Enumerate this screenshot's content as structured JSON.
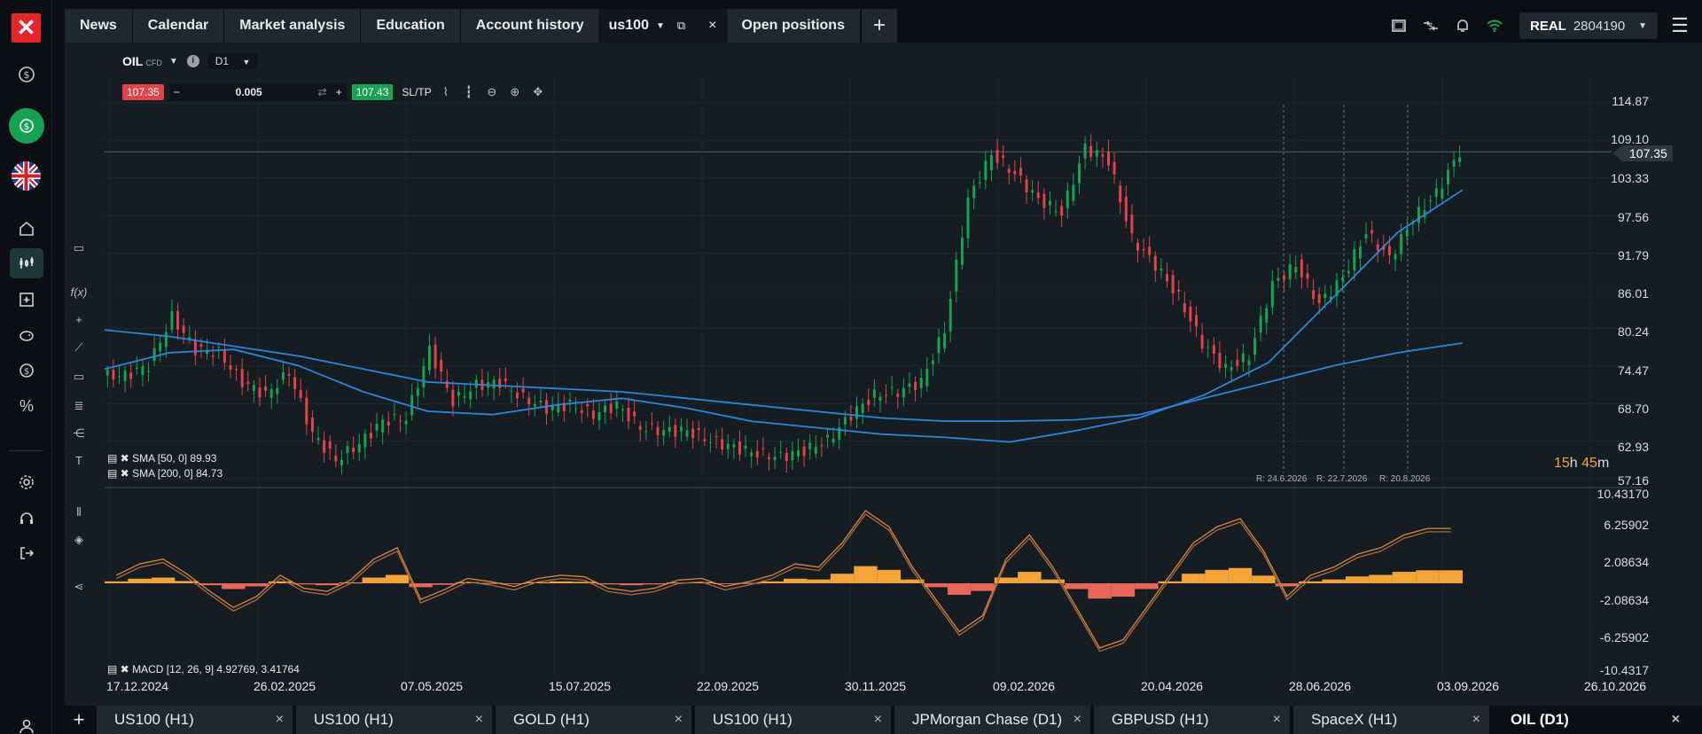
{
  "brand": {
    "logo_icon": "xtb-logo-icon"
  },
  "rail": {
    "icons": [
      "dollar-circle-icon",
      "deposit-icon",
      "uk-flag-icon",
      "home-icon",
      "charts-icon",
      "news-icon",
      "piggy-bank-icon",
      "money-icon",
      "percent-icon",
      "settings-icon",
      "headset-icon",
      "logout-icon",
      "user-icon"
    ]
  },
  "topbar": {
    "tabs": [
      "News",
      "Calendar",
      "Market analysis",
      "Education",
      "Account history"
    ],
    "symbol_tab": "us100",
    "open_positions": "Open positions",
    "add": "+"
  },
  "account": {
    "type": "REAL",
    "number": "2804190"
  },
  "chart": {
    "symbol": "OIL",
    "symbol_type": "CFD",
    "timeframe": "D1",
    "sell_price": "107.35",
    "buy_price": "107.43",
    "volume": "0.005",
    "sltp": "SL/TP",
    "current_price": "107.35",
    "timer_hours": "15",
    "timer_h": "h",
    "timer_minutes": "45",
    "timer_m": "m",
    "sma50": "SMA [50, 0] 89.93",
    "sma200": "SMA [200, 0] 84.73",
    "macd": "MACD [12, 26, 9] 4.92769, 3.41764",
    "r_lines": [
      "R: 24.6.2026",
      "R: 22.7.2026",
      "R: 20.8.2026"
    ]
  },
  "chart_data": {
    "type": "line",
    "title": "",
    "price_axis": [
      "114.87",
      "109.10",
      "103.33",
      "97.56",
      "91.79",
      "86.01",
      "80.24",
      "74.47",
      "68.70",
      "62.93",
      "57.16"
    ],
    "macd_axis": [
      "10.43170",
      "6.25902",
      "2.08634",
      "-2.08634",
      "-6.25902",
      "-10.4317"
    ],
    "x_labels": [
      "17.12.2024",
      "26.02.2025",
      "07.05.2025",
      "15.07.2025",
      "22.09.2025",
      "30.11.2025",
      "09.02.2026",
      "20.04.2026",
      "28.06.2026",
      "03.09.2026",
      "26.10.2026"
    ],
    "ylim": [
      57.16,
      114.87
    ],
    "x": [
      0,
      30,
      60,
      90,
      120,
      150,
      180,
      210,
      240,
      270,
      300,
      330,
      360,
      390,
      420,
      450,
      480,
      510,
      540,
      570,
      600,
      630
    ],
    "series": [
      {
        "name": "SMA [50, 0]",
        "color": "#2b86d9",
        "values": [
          74.0,
          76.5,
          77.0,
          74.5,
          70.5,
          67.5,
          67.0,
          68.5,
          69.5,
          68.0,
          66.0,
          65.0,
          64.0,
          63.5,
          62.8,
          64.5,
          66.5,
          70.0,
          75.0,
          85.0,
          95.0,
          101.5
        ]
      },
      {
        "name": "SMA [200, 0]",
        "color": "#2b86d9",
        "values": [
          80.0,
          79.0,
          77.5,
          76.0,
          74.0,
          72.0,
          71.5,
          71.0,
          70.5,
          69.5,
          68.5,
          67.5,
          66.5,
          66.0,
          66.0,
          66.2,
          67.0,
          69.5,
          72.0,
          74.5,
          76.5,
          78.0
        ]
      }
    ],
    "candles_close": [
      73.0,
      74.5,
      82.0,
      77.0,
      76.5,
      72.0,
      70.0,
      73.5,
      64.0,
      60.0,
      62.5,
      66.0,
      66.5,
      77.0,
      69.0,
      71.5,
      72.0,
      69.5,
      68.0,
      68.5,
      67.0,
      68.5,
      65.0,
      64.5,
      64.5,
      63.0,
      62.0,
      61.0,
      60.5,
      61.5,
      63.0,
      67.0,
      70.0,
      70.5,
      72.0,
      80.0,
      100.0,
      107.0,
      104.0,
      100.0,
      98.0,
      108.0,
      106.0,
      94.0,
      90.0,
      85.0,
      78.0,
      74.0,
      76.0,
      87.0,
      90.0,
      84.0,
      88.0,
      95.0,
      91.0,
      97.0,
      101.0,
      107.35
    ],
    "macd_values": [
      0.5,
      1.2,
      1.5,
      0.6,
      -0.5,
      -1.5,
      -0.8,
      0.5,
      -0.3,
      -0.5,
      0.2,
      1.5,
      2.2,
      -1.0,
      -0.4,
      0.3,
      0.1,
      -0.2,
      0.3,
      0.5,
      0.4,
      -0.3,
      -0.5,
      -0.3,
      0.2,
      0.3,
      -0.2,
      0.1,
      0.5,
      1.2,
      1.0,
      2.5,
      4.5,
      3.5,
      1.0,
      -1.0,
      -3.0,
      -2.0,
      1.5,
      3.0,
      1.0,
      -1.5,
      -4.0,
      -3.5,
      -1.5,
      0.5,
      2.5,
      3.5,
      4.0,
      2.0,
      -0.8,
      0.5,
      1.0,
      1.8,
      2.2,
      3.0,
      3.4,
      3.4
    ]
  },
  "bottom_tabs": [
    {
      "label": "US100 (H1)",
      "active": false
    },
    {
      "label": "US100 (H1)",
      "active": false
    },
    {
      "label": "GOLD (H1)",
      "active": false
    },
    {
      "label": "US100 (H1)",
      "active": false
    },
    {
      "label": "JPMorgan Chase (D1)",
      "active": false
    },
    {
      "label": "GBPUSD (H1)",
      "active": false
    },
    {
      "label": "SpaceX (H1)",
      "active": false
    },
    {
      "label": "OIL (D1)",
      "active": true
    }
  ],
  "close_symbol": "×",
  "colors": {
    "up": "#17a352",
    "down": "#e2424a",
    "macd_pos": "#f4a436",
    "macd_neg": "#e7685a",
    "sma": "#2b86d9",
    "accent": "#15a352"
  }
}
